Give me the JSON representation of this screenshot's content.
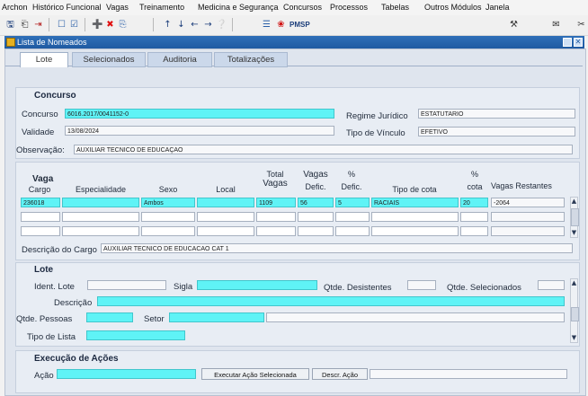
{
  "menu": [
    "Archon",
    "Histórico Funcional",
    "Vagas",
    "Treinamento",
    "Medicina e Segurança",
    "Concursos",
    "Processos",
    "Tabelas",
    "Outros Módulos",
    "Janela"
  ],
  "toolbar": {
    "pmsp_label": "PMSP"
  },
  "window": {
    "title": "Lista de Nomeados"
  },
  "tabs": [
    "Lote",
    "Selecionados",
    "Auditoria",
    "Totalizações"
  ],
  "concurso": {
    "section": "Concurso",
    "concurso_label": "Concurso",
    "concurso_value": "6016.2017/0041152-0",
    "validade_label": "Validade",
    "validade_value": "13/08/2024",
    "observacao_label": "Observação:",
    "observacao_value": "AUXILIAR TECNICO DE EDUCAÇAO",
    "regime_label": "Regime Jurídico",
    "regime_value": "ESTATUTARIO",
    "vinculo_label": "Tipo de Vínculo",
    "vinculo_value": "EFETIVO"
  },
  "vagas": {
    "headers": {
      "vaga": "Vaga",
      "cargo": "Cargo",
      "especialidade": "Especialidade",
      "sexo": "Sexo",
      "local": "Local",
      "total_vagas_1": "Total",
      "total_vagas_2": "Vagas",
      "vagas_defic_1": "Vagas",
      "vagas_defic_2": "Defic.",
      "pct_defic_1": "%",
      "pct_defic_2": "Defic.",
      "tipo_cota": "Tipo de cota",
      "pct_cota_1": "%",
      "pct_cota_2": "cota",
      "vagas_restantes": "Vagas Restantes"
    },
    "row": {
      "cargo": "236018",
      "especialidade": "",
      "sexo": "Ambos",
      "local": "",
      "total_vagas": "1109",
      "vagas_defic": "56",
      "pct_defic": "5",
      "tipo_cota": "RACIAIS",
      "pct_cota": "20",
      "vagas_restantes": "-2064"
    },
    "descricao_cargo_label": "Descrição do Cargo",
    "descricao_cargo_value": "AUXILIAR TECNICO DE EDUCACAO CAT 1"
  },
  "lote": {
    "section": "Lote",
    "ident_label": "Ident. Lote",
    "sigla_label": "Sigla",
    "desistentes_label": "Qtde. Desistentes",
    "selecionados_label": "Qtde. Selecionados",
    "descricao_label": "Descrição",
    "pessoas_label": "Qtde. Pessoas",
    "setor_label": "Setor",
    "tipo_lista_label": "Tipo de Lista"
  },
  "execucao": {
    "section": "Execução de Ações",
    "acao_label": "Ação",
    "executar_button": "Executar Ação Selecionada",
    "descr_button": "Descr. Ação"
  },
  "colors": {
    "title_blue": "#2f6fb8",
    "field_cyan": "#5ff3f6"
  }
}
